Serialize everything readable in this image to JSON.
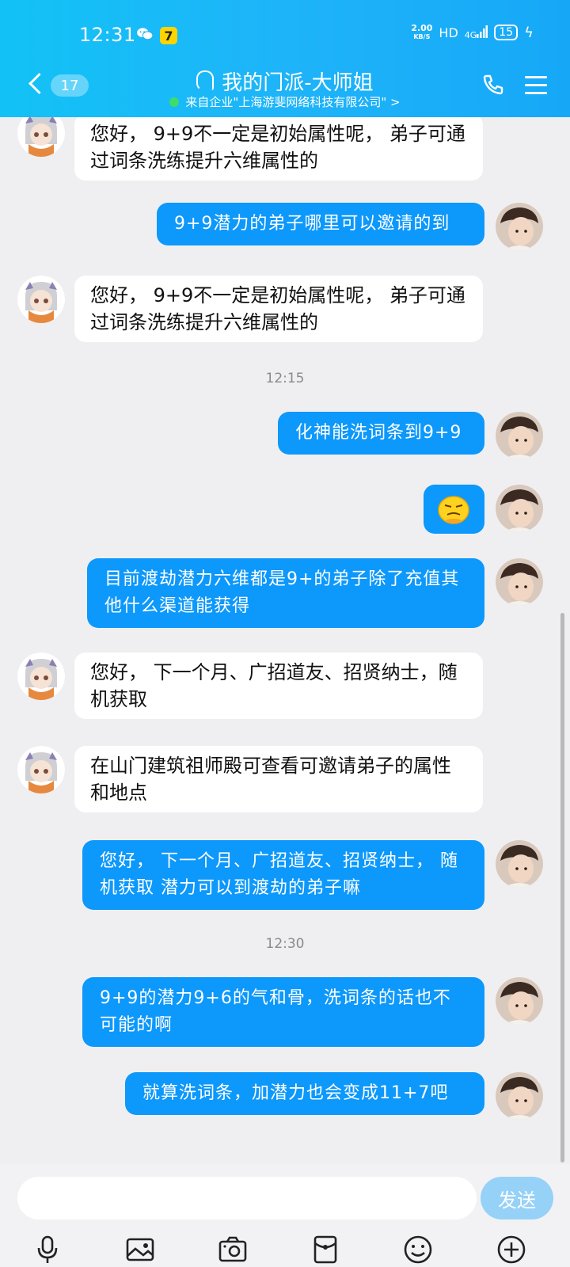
{
  "status_bar": {
    "time": "12:31",
    "net_speed_top": "2.00",
    "net_speed_unit": "KB/S",
    "hd": "HD",
    "signal": "4G",
    "battery": "15"
  },
  "header": {
    "unread_count": "17",
    "title": "我的门派-大师姐",
    "subtitle": "来自企业\"上海游斐网络科技有限公司\" >"
  },
  "messages": [
    {
      "from": "agent",
      "text": "您好， 9+9不一定是初始属性呢， 弟子可通过词条洗练提升六维属性的"
    },
    {
      "from": "user",
      "text": "9+9潜力的弟子哪里可以邀请的到"
    },
    {
      "from": "agent",
      "text": "您好， 9+9不一定是初始属性呢， 弟子可通过词条洗练提升六维属性的"
    },
    {
      "timestamp": "12:15"
    },
    {
      "from": "user",
      "text": "化神能洗词条到9+9"
    },
    {
      "from": "user",
      "sticker": "smug-emoji-icon"
    },
    {
      "from": "user",
      "text": "目前渡劫潜力六维都是9+的弟子除了充值其他什么渠道能获得"
    },
    {
      "from": "agent",
      "text": "您好， 下一个月、广招道友、招贤纳士，随机获取"
    },
    {
      "from": "agent",
      "text": "在山门建筑祖师殿可查看可邀请弟子的属性和地点"
    },
    {
      "from": "user",
      "text": "您好， 下一个月、广招道友、招贤纳士， 随机获取 潜力可以到渡劫的弟子嘛"
    },
    {
      "timestamp": "12:30"
    },
    {
      "from": "user",
      "text": "9+9的潜力9+6的气和骨，洗词条的话也不可能的啊"
    },
    {
      "from": "user",
      "text": "就算洗词条，加潜力也会变成11+7吧"
    }
  ],
  "composer": {
    "placeholder": "",
    "send_label": "发送"
  },
  "toolbar": [
    "mic-icon",
    "image-icon",
    "camera-icon",
    "red-packet-icon",
    "emoji-icon",
    "plus-icon"
  ],
  "colors": {
    "header": "#1eb4f9",
    "bubble_out": "#0d98fb",
    "bubble_in": "#ffffff",
    "background": "#efeff2",
    "send_button": "#96d1f8"
  }
}
